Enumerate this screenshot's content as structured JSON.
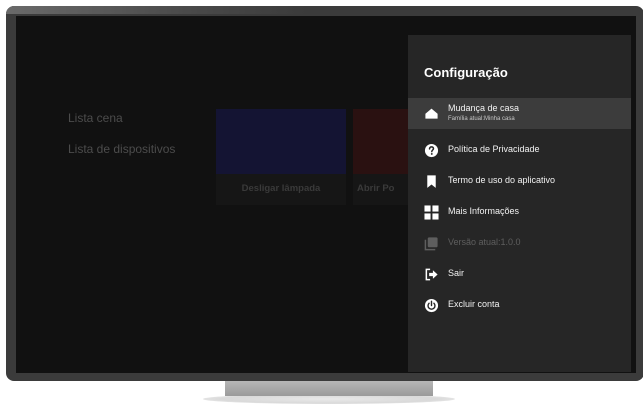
{
  "background_app": {
    "menu": [
      {
        "label": "Lista cena"
      },
      {
        "label": "Lista de dispositivos"
      }
    ],
    "cards": [
      {
        "label": "Desligar lâmpada",
        "color": "#141433"
      },
      {
        "label": "Abrir Po",
        "color": "#2a1111"
      }
    ]
  },
  "settings_panel": {
    "title": "Configuração",
    "items": [
      {
        "label": "Mudança de casa",
        "sublabel": "Família atual:Minha casa",
        "icon": "home-icon",
        "selected": true
      },
      {
        "label": "Política de Privacidade",
        "icon": "help-circle-icon"
      },
      {
        "label": "Termo de uso do aplicativo",
        "icon": "bookmark-icon"
      },
      {
        "label": "Mais Informações",
        "icon": "grid-icon"
      },
      {
        "label": "Versão atual:1.0.0",
        "icon": "copy-icon",
        "disabled": true
      },
      {
        "label": "Sair",
        "icon": "logout-icon"
      },
      {
        "label": "Excluir conta",
        "icon": "power-icon"
      }
    ]
  },
  "colors": {
    "panel_bg": "#262626",
    "selected_bg": "#3c3c3c",
    "screen_bg": "#111111",
    "bezel": "#3b3b3b"
  }
}
